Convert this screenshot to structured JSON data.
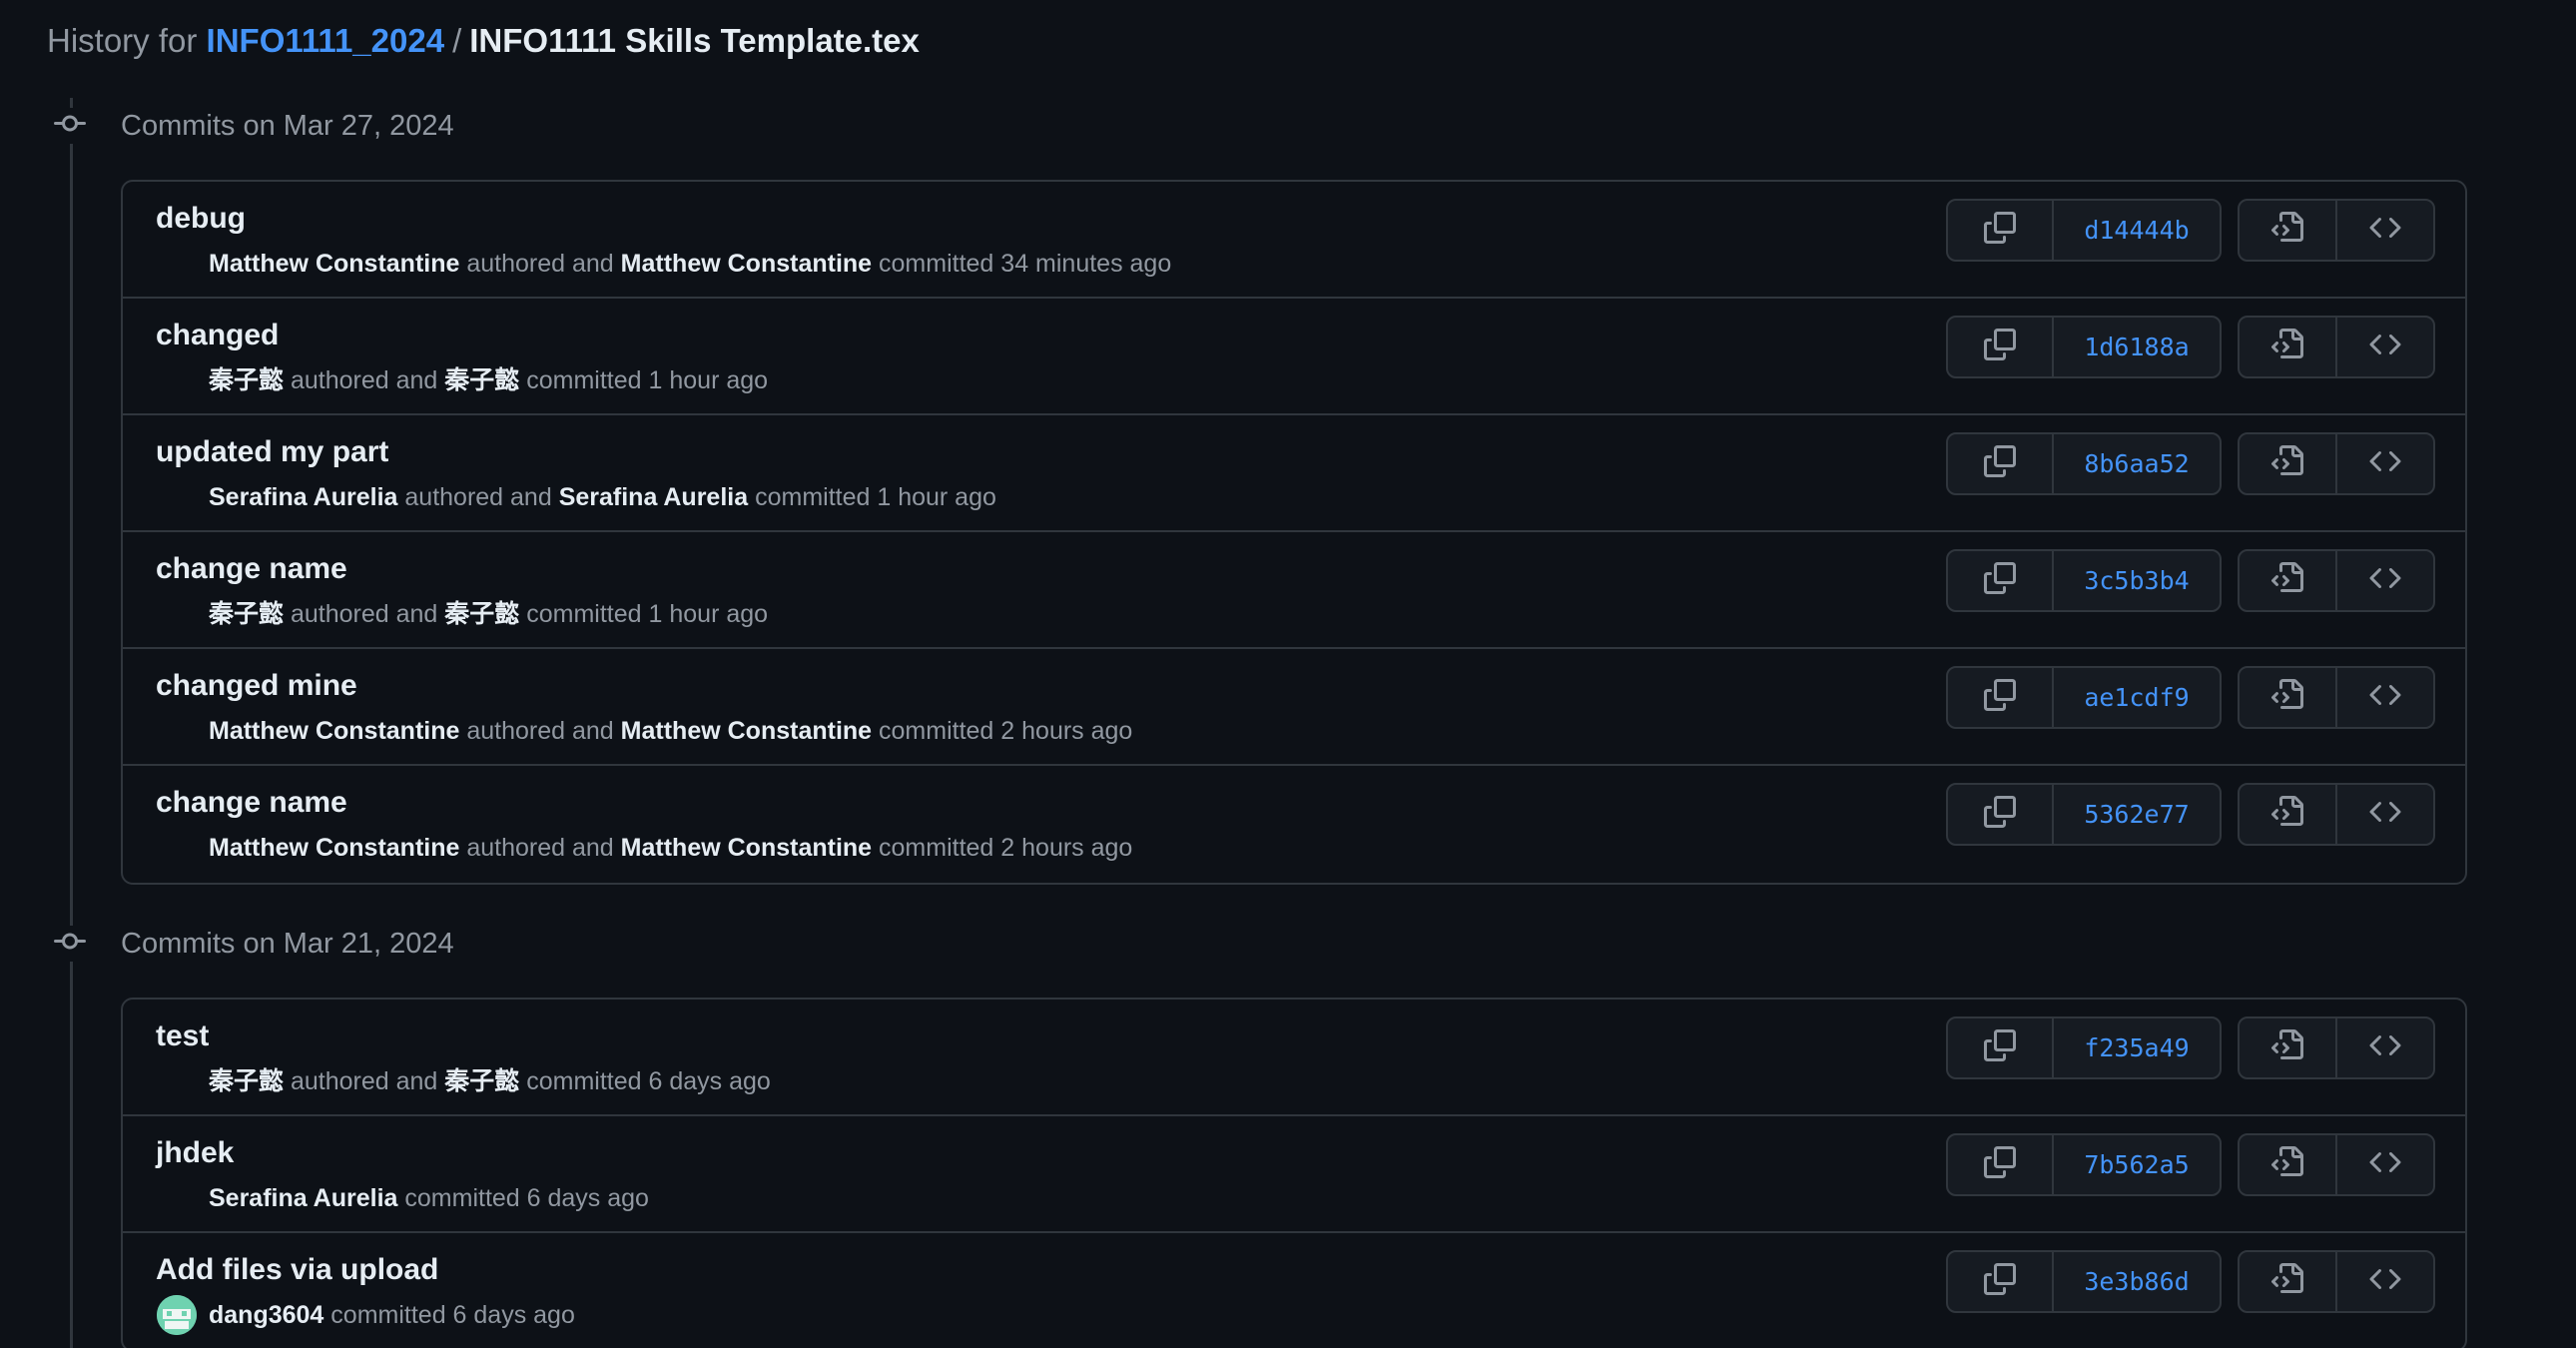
{
  "header": {
    "prefix": "History for",
    "repo": "INFO1111_2024",
    "separator": "/",
    "file": "INFO1111 Skills Template.tex"
  },
  "groups": [
    {
      "label": "Commits on Mar 27, 2024",
      "commits": [
        {
          "message": "debug",
          "author": "Matthew Constantine",
          "authored_text": "authored and",
          "committer": "Matthew Constantine",
          "committed_text": "committed 34 minutes ago",
          "sha": "d14444b"
        },
        {
          "message": "changed",
          "author": "秦子懿",
          "authored_text": "authored and",
          "committer": "秦子懿",
          "committed_text": "committed 1 hour ago",
          "sha": "1d6188a"
        },
        {
          "message": "updated my part",
          "author": "Serafina Aurelia",
          "authored_text": "authored and",
          "committer": "Serafina Aurelia",
          "committed_text": "committed 1 hour ago",
          "sha": "8b6aa52"
        },
        {
          "message": "change name",
          "author": "秦子懿",
          "authored_text": "authored and",
          "committer": "秦子懿",
          "committed_text": "committed 1 hour ago",
          "sha": "3c5b3b4"
        },
        {
          "message": "changed mine",
          "author": "Matthew Constantine",
          "authored_text": "authored and",
          "committer": "Matthew Constantine",
          "committed_text": "committed 2 hours ago",
          "sha": "ae1cdf9"
        },
        {
          "message": "change name",
          "author": "Matthew Constantine",
          "authored_text": "authored and",
          "committer": "Matthew Constantine",
          "committed_text": "committed 2 hours ago",
          "sha": "5362e77"
        }
      ]
    },
    {
      "label": "Commits on Mar 21, 2024",
      "commits": [
        {
          "message": "test",
          "author": "秦子懿",
          "authored_text": "authored and",
          "committer": "秦子懿",
          "committed_text": "committed 6 days ago",
          "sha": "f235a49"
        },
        {
          "message": "jhdek",
          "author": "Serafina Aurelia",
          "authored_text": "",
          "committer": "",
          "committed_text": "committed 6 days ago",
          "sha": "7b562a5"
        },
        {
          "message": "Add files via upload",
          "author": "dang3604",
          "authored_text": "",
          "committer": "",
          "committed_text": "committed 6 days ago",
          "sha": "3e3b86d",
          "avatar": true
        }
      ]
    }
  ],
  "icons": {
    "copy": "copy-icon",
    "browse_file": "file-code-icon",
    "browse_repo": "code-icon",
    "timeline": "git-commit-icon"
  },
  "colors": {
    "background": "#0d1117",
    "border": "#30363d",
    "link": "#4493f8",
    "muted": "#9198a1",
    "text": "#e6edf3"
  }
}
